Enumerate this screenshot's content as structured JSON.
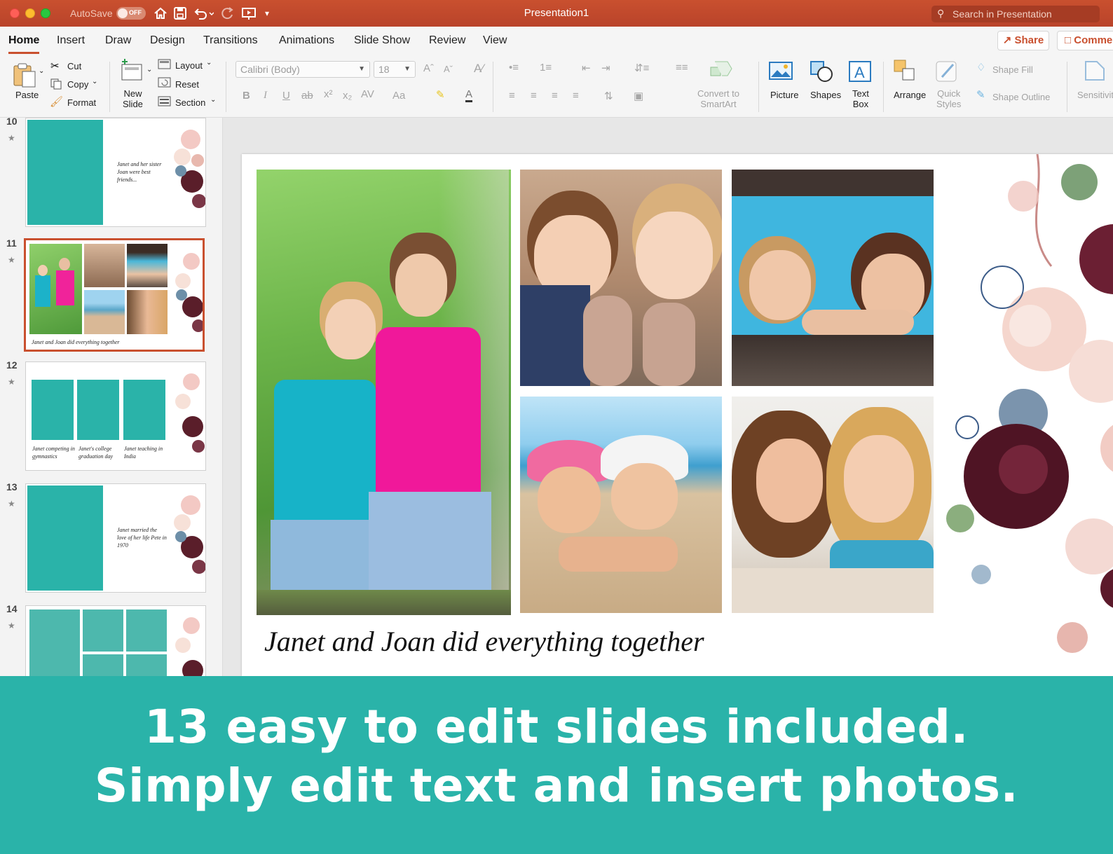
{
  "window": {
    "title": "Presentation1",
    "autosave_label": "AutoSave",
    "autosave_state": "OFF",
    "search_placeholder": "Search in Presentation"
  },
  "tabs": [
    "Home",
    "Insert",
    "Draw",
    "Design",
    "Transitions",
    "Animations",
    "Slide Show",
    "Review",
    "View"
  ],
  "actions": {
    "share": "Share",
    "comments": "Comme"
  },
  "ribbon": {
    "paste": "Paste",
    "cut": "Cut",
    "copy": "Copy",
    "format": "Format",
    "new_slide": "New\nSlide",
    "layout": "Layout",
    "reset": "Reset",
    "section": "Section",
    "font_name": "Calibri (Body)",
    "font_size": "18",
    "convert_smartart": "Convert to\nSmartArt",
    "picture": "Picture",
    "shapes": "Shapes",
    "text_box": "Text\nBox",
    "arrange": "Arrange",
    "quick_styles": "Quick\nStyles",
    "shape_fill": "Shape Fill",
    "shape_outline": "Shape Outline",
    "sensitivity": "Sensitivit"
  },
  "thumbnails": [
    {
      "number": "10",
      "caption": "Janet and her sister Joan were best friends..."
    },
    {
      "number": "11",
      "caption": "Janet and Joan did everything together"
    },
    {
      "number": "12",
      "captions": [
        "Janet competing in gymnastics",
        "Janet's college graduation day",
        "Janet teaching in India"
      ]
    },
    {
      "number": "13",
      "caption": "Janet married the love of her life Pete in 1970"
    },
    {
      "number": "14"
    }
  ],
  "slide": {
    "caption": "Janet and Joan did everything together"
  },
  "banner": {
    "line1": "13 easy to edit slides included.",
    "line2": "Simply edit text and insert photos."
  },
  "colors": {
    "accent": "#c9502f",
    "teal": "#2ab3a9"
  }
}
